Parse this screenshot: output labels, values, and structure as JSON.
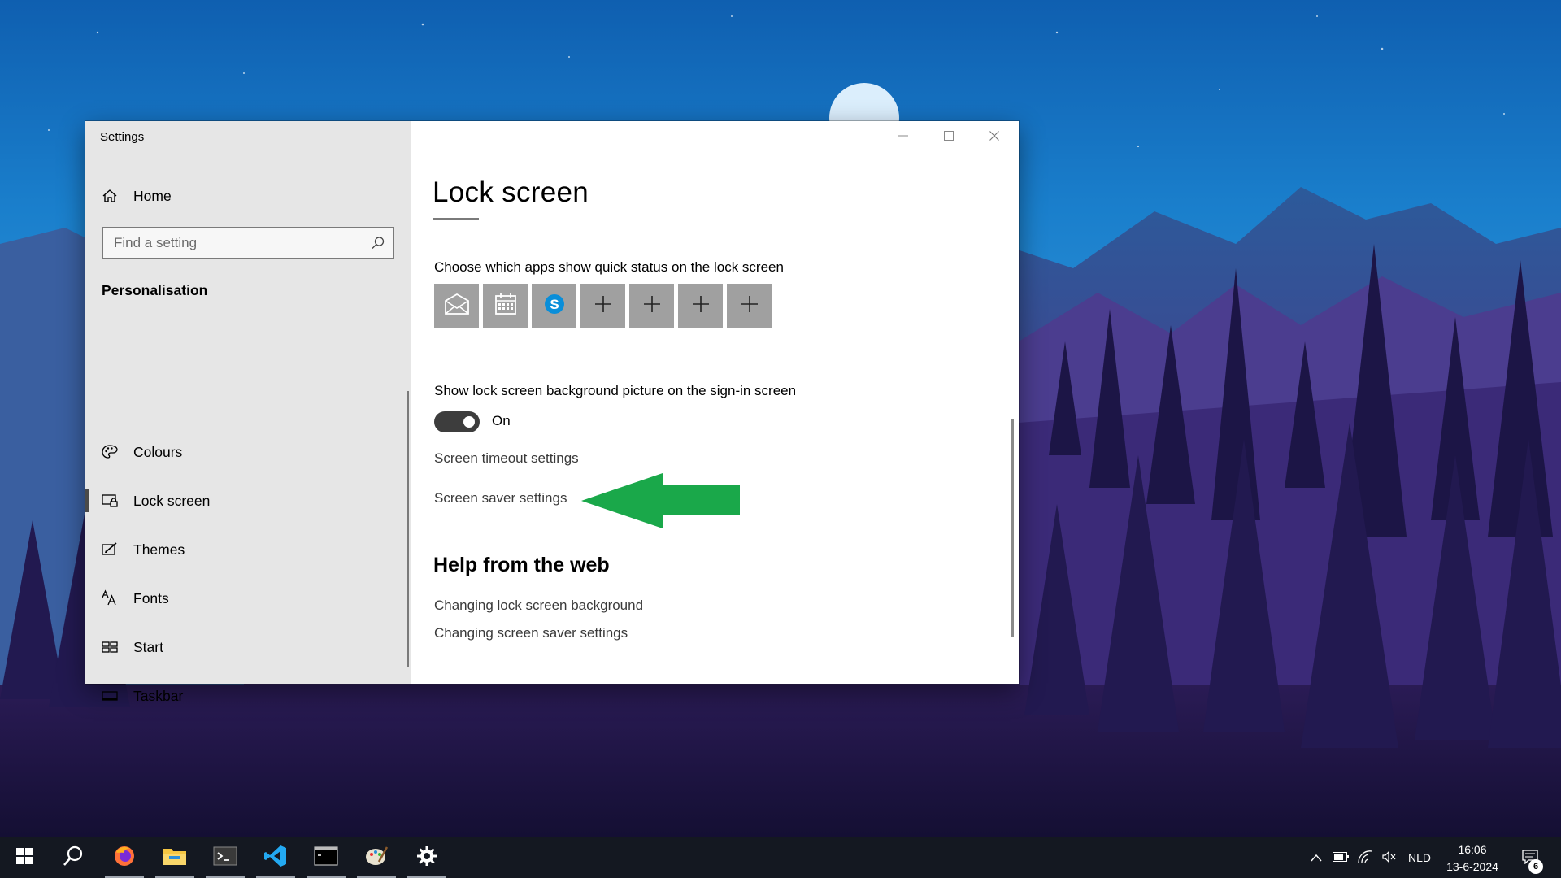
{
  "window": {
    "title": "Settings",
    "controls": [
      "minimize",
      "maximize",
      "close"
    ]
  },
  "sidebar": {
    "home_label": "Home",
    "search_placeholder": "Find a setting",
    "section_title": "Personalisation",
    "items": [
      {
        "label": "Colours",
        "icon": "palette-icon",
        "selected": false
      },
      {
        "label": "Lock screen",
        "icon": "lock-screen-icon",
        "selected": true
      },
      {
        "label": "Themes",
        "icon": "themes-icon",
        "selected": false
      },
      {
        "label": "Fonts",
        "icon": "fonts-icon",
        "selected": false
      },
      {
        "label": "Start",
        "icon": "start-icon",
        "selected": false
      },
      {
        "label": "Taskbar",
        "icon": "taskbar-icon",
        "selected": false
      }
    ]
  },
  "main": {
    "title": "Lock screen",
    "quick_status_label": "Choose which apps show quick status on the lock screen",
    "quick_status_apps": [
      "mail-icon",
      "calendar-icon",
      "skype-icon",
      "add-icon",
      "add-icon",
      "add-icon",
      "add-icon"
    ],
    "signin_bg_label": "Show lock screen background picture on the sign-in screen",
    "signin_bg_toggle": {
      "value": true,
      "state_label": "On"
    },
    "screen_timeout_link": "Screen timeout settings",
    "screen_saver_link": "Screen saver settings",
    "help_title": "Help from the web",
    "help_links": [
      "Changing lock screen background",
      "Changing screen saver settings"
    ]
  },
  "annotation": {
    "arrow_color": "#1aa84a",
    "points_to": "Screen saver settings"
  },
  "taskbar": {
    "apps": [
      "start-icon",
      "search-icon",
      "firefox-icon",
      "file-explorer-icon",
      "terminal-icon",
      "vscode-icon",
      "command-prompt-icon",
      "paint-icon",
      "settings-icon"
    ],
    "tray": {
      "language": "NLD",
      "time": "16:06",
      "date": "13-6-2024",
      "notification_count": "6"
    }
  },
  "colors": {
    "accent": "#4a4a4a",
    "sidebar_bg": "#e6e6e6",
    "taskbar_bg": "#141821",
    "tile_bg": "#a0a0a0"
  }
}
